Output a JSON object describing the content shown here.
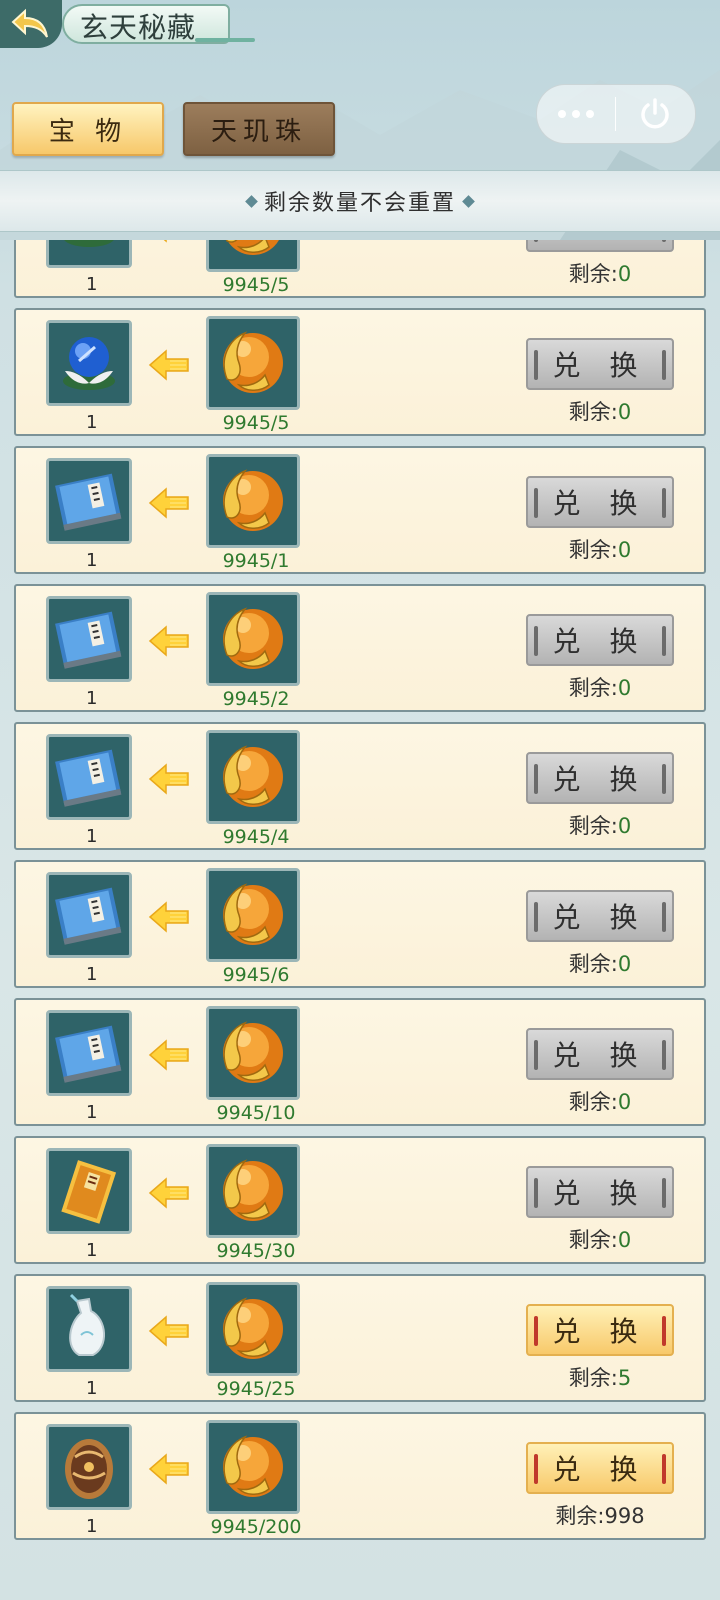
{
  "header": {
    "title": "玄天秘藏"
  },
  "tabs": [
    {
      "label": "宝 物"
    },
    {
      "label": "天玑珠"
    }
  ],
  "notice": "剩余数量不会重置",
  "remain_prefix": "剩余:",
  "button_label": "兑 换",
  "colors": {
    "active_button": "#f8c96a",
    "disabled_button": "#b3b3b3",
    "cost_text": "#2f7a2f"
  },
  "rows": [
    {
      "item_icon": "lotus-icon",
      "qty": "1",
      "cost": "9945/5",
      "remain": "0",
      "enabled": false
    },
    {
      "item_icon": "blue-orb-lotus-icon",
      "qty": "1",
      "cost": "9945/5",
      "remain": "0",
      "enabled": false
    },
    {
      "item_icon": "blue-book-icon",
      "qty": "1",
      "cost": "9945/1",
      "remain": "0",
      "enabled": false
    },
    {
      "item_icon": "blue-book-icon",
      "qty": "1",
      "cost": "9945/2",
      "remain": "0",
      "enabled": false
    },
    {
      "item_icon": "blue-book-icon",
      "qty": "1",
      "cost": "9945/4",
      "remain": "0",
      "enabled": false
    },
    {
      "item_icon": "blue-book-icon",
      "qty": "1",
      "cost": "9945/6",
      "remain": "0",
      "enabled": false
    },
    {
      "item_icon": "blue-book-icon",
      "qty": "1",
      "cost": "9945/10",
      "remain": "0",
      "enabled": false
    },
    {
      "item_icon": "golden-token-icon",
      "qty": "1",
      "cost": "9945/30",
      "remain": "0",
      "enabled": false
    },
    {
      "item_icon": "porcelain-vase-icon",
      "qty": "1",
      "cost": "9945/25",
      "remain": "5",
      "enabled": true
    },
    {
      "item_icon": "dragon-egg-icon",
      "qty": "1",
      "cost": "9945/200",
      "remain": "998",
      "enabled": true
    }
  ]
}
